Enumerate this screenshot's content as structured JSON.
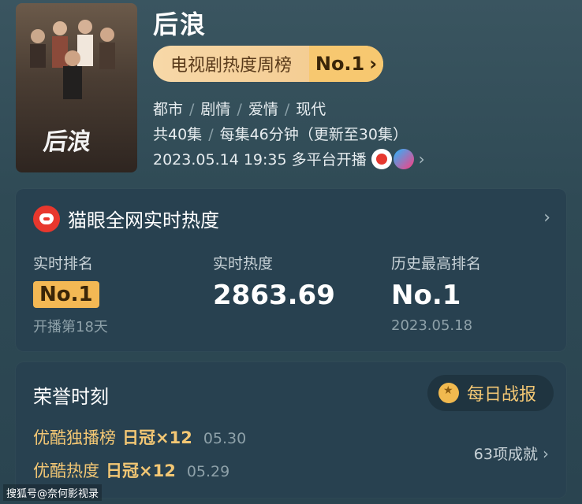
{
  "show": {
    "poster_title": "后浪",
    "title": "后浪",
    "rank_pill": {
      "label": "电视剧热度周榜",
      "badge": "No.1",
      "chevron": "›"
    },
    "genres": [
      "都市",
      "剧情",
      "爱情",
      "现代"
    ],
    "episodes": "共40集",
    "duration": "每集46分钟（更新至30集）",
    "release": "2023.05.14 19:35 多平台开播",
    "platform_icons": [
      "red-circle-platform-icon",
      "gradient-platform-icon"
    ]
  },
  "hot_card": {
    "title": "猫眼全网实时热度",
    "stats": {
      "rank_label": "实时排名",
      "rank_value": "No.1",
      "rank_sub": "开播第18天",
      "heat_label": "实时热度",
      "heat_value": "2863.69",
      "hist_label": "历史最高排名",
      "hist_value": "No.1",
      "hist_sub": "2023.05.18"
    }
  },
  "honor_card": {
    "title": "荣誉时刻",
    "daily_button": "每日战报",
    "rows": [
      {
        "name": "优酷独播榜",
        "value": "日冠×12",
        "date": "05.30"
      },
      {
        "name": "优酷热度",
        "value": "日冠×12",
        "date": "05.29"
      }
    ],
    "achievements": "63项成就"
  },
  "watermark": "搜狐号@奈何影视录",
  "colors": {
    "accent_gold": "#f3c774",
    "badge_gold": "#f3b854",
    "brand_red": "#e8372d"
  }
}
